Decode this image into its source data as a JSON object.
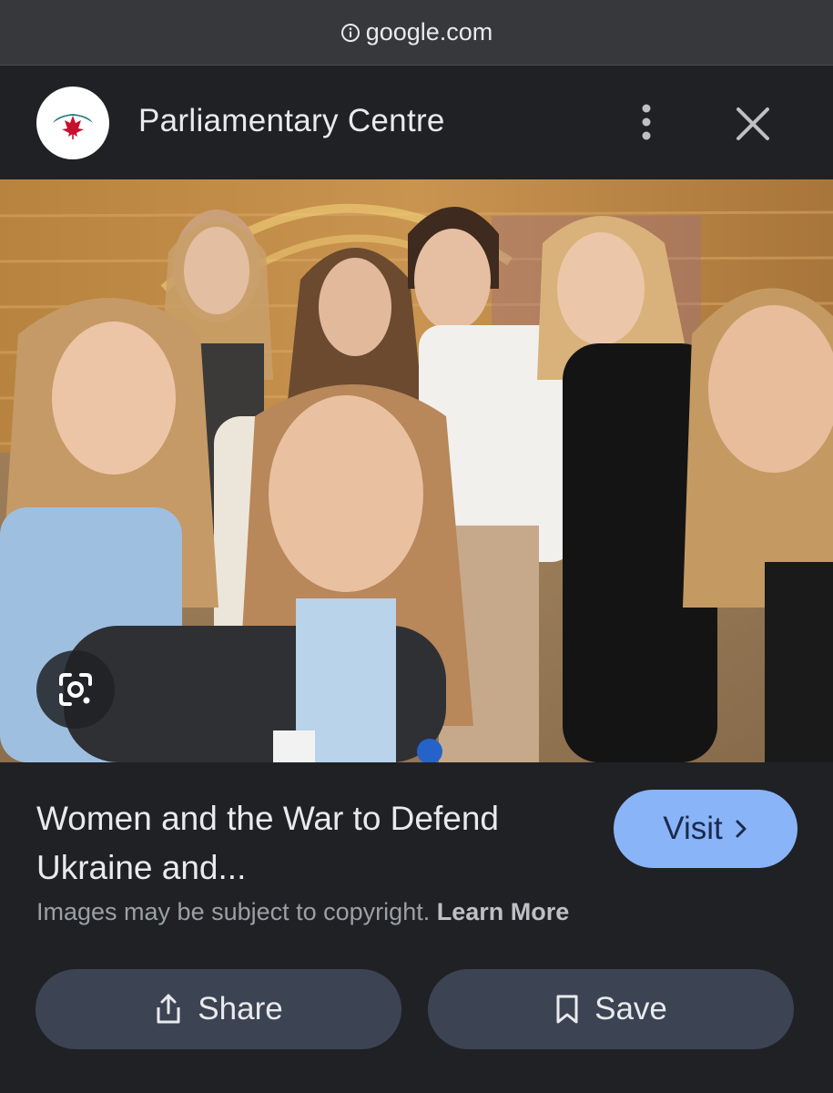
{
  "url_bar": {
    "domain": "google.com",
    "icon": "info-icon"
  },
  "header": {
    "site_name": "Parliamentary Centre",
    "logo_icon": "maple-leaf-logo",
    "menu_icon": "more-vert-icon",
    "close_icon": "close-icon"
  },
  "image": {
    "lens_icon": "google-lens-icon"
  },
  "result": {
    "title": "Women and the War to Defend Ukraine and...",
    "visit_label": "Visit",
    "copyright_text": "Images may be subject to copyright.",
    "learn_more_label": "Learn More"
  },
  "actions": {
    "share_label": "Share",
    "save_label": "Save"
  },
  "colors": {
    "background": "#202124",
    "url_bar": "#37383b",
    "visit_button": "#8ab4f8",
    "action_button": "#3c4453",
    "logo_red": "#c8102e",
    "logo_teal": "#2a7f8a"
  }
}
